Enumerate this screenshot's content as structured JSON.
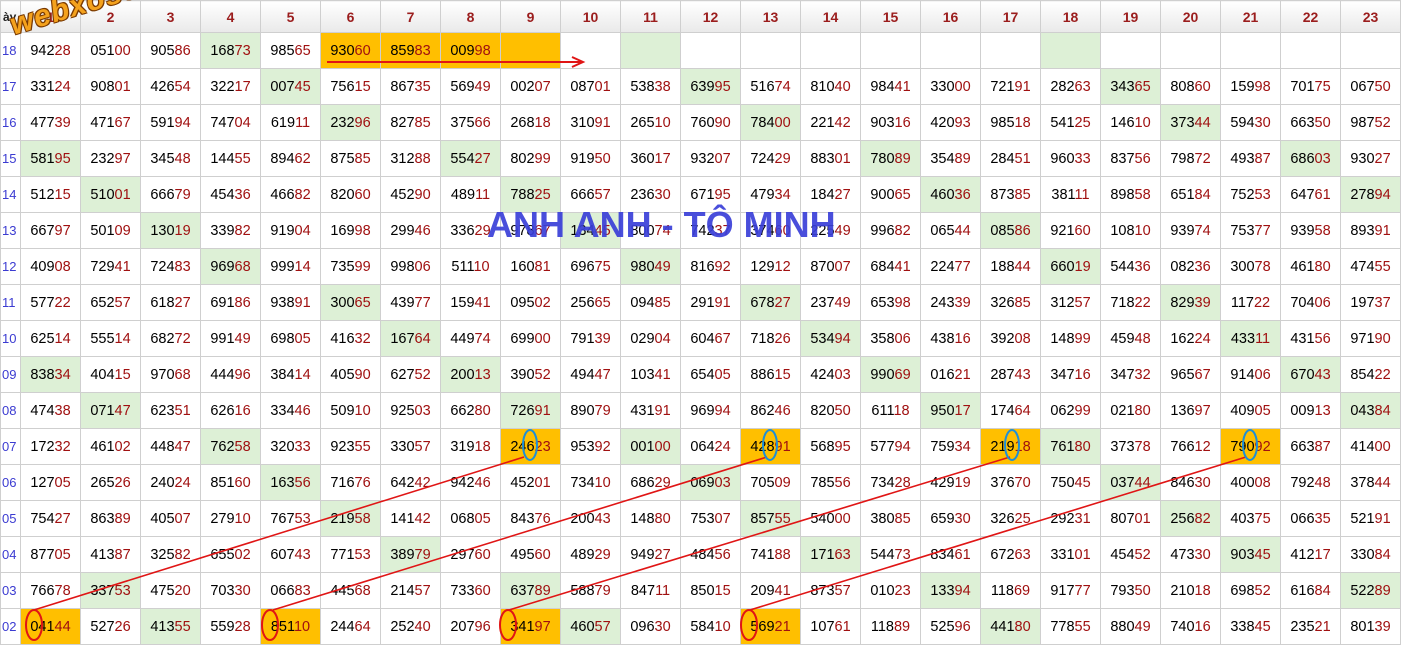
{
  "header": {
    "corner_label": "ày",
    "columns": [
      "1",
      "2",
      "3",
      "4",
      "5",
      "6",
      "7",
      "8",
      "9",
      "10",
      "11",
      "12",
      "13",
      "14",
      "15",
      "16",
      "17",
      "18",
      "19",
      "20",
      "21",
      "22",
      "23"
    ]
  },
  "rows": [
    {
      "label": "18",
      "cells": [
        "94228",
        "05100",
        "90586",
        "16873",
        "98565",
        "93060",
        "85983",
        "00998",
        "",
        "",
        "",
        "",
        "",
        "",
        "",
        "",
        "",
        "",
        "",
        "",
        "",
        "",
        ""
      ],
      "highlight": {
        "4": "g",
        "6": "o",
        "7": "o",
        "8": "o",
        "9": "o",
        "11": "g",
        "18": "g"
      }
    },
    {
      "label": "17",
      "cells": [
        "33124",
        "90801",
        "42654",
        "32217",
        "00745",
        "75615",
        "86735",
        "56949",
        "00207",
        "08701",
        "53838",
        "63995",
        "51674",
        "81040",
        "98441",
        "33000",
        "72191",
        "28263",
        "34365",
        "80860",
        "15998",
        "70175",
        "06750"
      ],
      "highlight": {
        "5": "g",
        "12": "g",
        "19": "g"
      }
    },
    {
      "label": "16",
      "cells": [
        "47739",
        "47167",
        "59194",
        "74704",
        "61911",
        "23296",
        "82785",
        "37566",
        "26818",
        "31091",
        "26510",
        "76090",
        "78400",
        "22142",
        "90316",
        "42093",
        "98518",
        "54125",
        "14610",
        "37344",
        "59430",
        "66350",
        "98752"
      ],
      "highlight": {
        "6": "g",
        "13": "g",
        "20": "g"
      }
    },
    {
      "label": "15",
      "cells": [
        "58195",
        "23297",
        "34548",
        "14455",
        "89462",
        "87585",
        "31288",
        "55427",
        "80299",
        "91950",
        "36017",
        "93207",
        "72429",
        "88301",
        "78089",
        "35489",
        "28451",
        "96033",
        "83756",
        "79872",
        "49387",
        "68603",
        "93027"
      ],
      "highlight": {
        "1": "g",
        "8": "g",
        "15": "g",
        "22": "g"
      }
    },
    {
      "label": "14",
      "cells": [
        "51215",
        "51001",
        "66679",
        "45436",
        "46682",
        "82060",
        "45290",
        "48911",
        "78825",
        "66657",
        "23630",
        "67195",
        "47934",
        "18427",
        "90065",
        "46036",
        "87385",
        "38111",
        "89858",
        "65184",
        "75253",
        "64761",
        "27894"
      ],
      "highlight": {
        "2": "g",
        "9": "g",
        "16": "g",
        "23": "g"
      }
    },
    {
      "label": "13",
      "cells": [
        "66797",
        "50109",
        "13019",
        "33982",
        "91904",
        "16998",
        "29946",
        "33629",
        "97867",
        "13445",
        "80074",
        "74237",
        "37460",
        "22549",
        "99682",
        "06544",
        "08586",
        "92160",
        "10810",
        "93974",
        "75377",
        "93958",
        "89391"
      ],
      "highlight": {
        "3": "g",
        "10": "g",
        "17": "g"
      }
    },
    {
      "label": "12",
      "cells": [
        "40908",
        "72941",
        "72483",
        "96968",
        "99914",
        "73599",
        "99806",
        "51110",
        "16081",
        "69675",
        "98049",
        "81692",
        "12912",
        "87007",
        "68441",
        "22477",
        "18844",
        "66019",
        "54436",
        "08236",
        "30078",
        "46180",
        "47455"
      ],
      "highlight": {
        "4": "g",
        "11": "g",
        "18": "g"
      }
    },
    {
      "label": "11",
      "cells": [
        "57722",
        "65257",
        "61827",
        "69186",
        "93891",
        "30065",
        "43977",
        "15941",
        "09502",
        "25665",
        "09485",
        "29191",
        "67827",
        "23749",
        "65398",
        "24339",
        "32685",
        "31257",
        "71822",
        "82939",
        "11722",
        "70406",
        "19737"
      ],
      "highlight": {
        "6": "g",
        "13": "g",
        "20": "g"
      }
    },
    {
      "label": "10",
      "cells": [
        "62514",
        "55514",
        "68272",
        "99149",
        "69805",
        "41632",
        "16764",
        "44974",
        "69900",
        "79139",
        "02904",
        "60467",
        "71826",
        "53494",
        "35806",
        "43816",
        "39208",
        "14899",
        "45948",
        "16224",
        "43311",
        "43156",
        "97190"
      ],
      "highlight": {
        "7": "g",
        "14": "g",
        "21": "g"
      }
    },
    {
      "label": "09",
      "cells": [
        "83834",
        "40415",
        "97068",
        "44496",
        "38414",
        "40590",
        "62752",
        "20013",
        "39052",
        "49447",
        "10341",
        "65405",
        "88615",
        "42403",
        "99069",
        "01621",
        "28743",
        "34716",
        "34732",
        "96567",
        "91406",
        "67043",
        "85422"
      ],
      "highlight": {
        "1": "g",
        "8": "g",
        "15": "g",
        "22": "g"
      }
    },
    {
      "label": "08",
      "cells": [
        "47438",
        "07147",
        "62351",
        "62616",
        "33446",
        "50910",
        "92503",
        "66280",
        "72691",
        "89079",
        "43191",
        "96994",
        "86246",
        "82050",
        "61118",
        "95017",
        "17464",
        "06299",
        "02180",
        "13697",
        "40905",
        "00913",
        "04384"
      ],
      "highlight": {
        "2": "g",
        "9": "g",
        "16": "g",
        "23": "g"
      }
    },
    {
      "label": "07",
      "cells": [
        "17232",
        "46102",
        "44847",
        "76258",
        "32033",
        "92355",
        "33057",
        "31918",
        "24623",
        "95392",
        "00100",
        "06424",
        "42891",
        "56895",
        "57794",
        "75934",
        "21918",
        "76180",
        "37378",
        "76612",
        "79092",
        "66387",
        "41400"
      ],
      "highlight": {
        "4": "g",
        "9": "o",
        "11": "g",
        "13": "o",
        "17": "o",
        "18": "g",
        "21": "o"
      }
    },
    {
      "label": "06",
      "cells": [
        "12705",
        "26526",
        "24024",
        "85160",
        "16356",
        "71676",
        "64242",
        "94246",
        "45201",
        "73410",
        "68629",
        "06903",
        "70509",
        "78556",
        "73428",
        "42919",
        "37670",
        "75045",
        "03744",
        "84630",
        "40008",
        "79248",
        "37844"
      ],
      "highlight": {
        "5": "g",
        "12": "g",
        "19": "g"
      }
    },
    {
      "label": "05",
      "cells": [
        "75427",
        "86389",
        "40507",
        "27910",
        "76753",
        "21958",
        "14142",
        "06805",
        "84376",
        "20043",
        "14880",
        "75307",
        "85755",
        "54000",
        "38085",
        "65930",
        "32625",
        "29231",
        "80701",
        "25682",
        "40375",
        "06635",
        "52191"
      ],
      "highlight": {
        "6": "g",
        "13": "g",
        "20": "g"
      }
    },
    {
      "label": "04",
      "cells": [
        "87705",
        "41387",
        "32582",
        "65502",
        "60743",
        "77153",
        "38979",
        "29760",
        "49560",
        "48929",
        "94927",
        "48456",
        "74188",
        "17163",
        "54473",
        "83461",
        "67263",
        "33101",
        "45452",
        "47330",
        "90345",
        "41217",
        "33084"
      ],
      "highlight": {
        "7": "g",
        "14": "g",
        "21": "g"
      }
    },
    {
      "label": "03",
      "cells": [
        "76678",
        "33753",
        "47520",
        "70330",
        "06683",
        "44568",
        "21457",
        "73360",
        "63789",
        "58879",
        "84711",
        "85015",
        "20941",
        "87357",
        "01023",
        "13394",
        "11869",
        "91777",
        "79350",
        "21018",
        "69852",
        "61684",
        "52289"
      ],
      "highlight": {
        "2": "g",
        "9": "g",
        "16": "g",
        "23": "g"
      }
    },
    {
      "label": "02",
      "cells": [
        "04144",
        "52726",
        "41355",
        "55928",
        "85110",
        "24464",
        "25240",
        "20796",
        "34197",
        "46057",
        "09630",
        "58410",
        "56921",
        "10761",
        "11889",
        "52596",
        "44180",
        "77855",
        "88049",
        "74016",
        "33845",
        "23521",
        "80139"
      ],
      "highlight": {
        "1": "o",
        "3": "g",
        "5": "o",
        "9": "o",
        "10": "g",
        "13": "o",
        "17": "g"
      }
    }
  ],
  "watermarks": {
    "site": "webxoso.net",
    "name": "ANH ANH - TÔ MINH"
  },
  "colors": {
    "green_cell": "#ddf0d6",
    "orange_cell": "#ffbf00",
    "red_mark": "#e01515",
    "blue_mark": "#1f8fd6",
    "header_text": "#9b1d1d"
  }
}
